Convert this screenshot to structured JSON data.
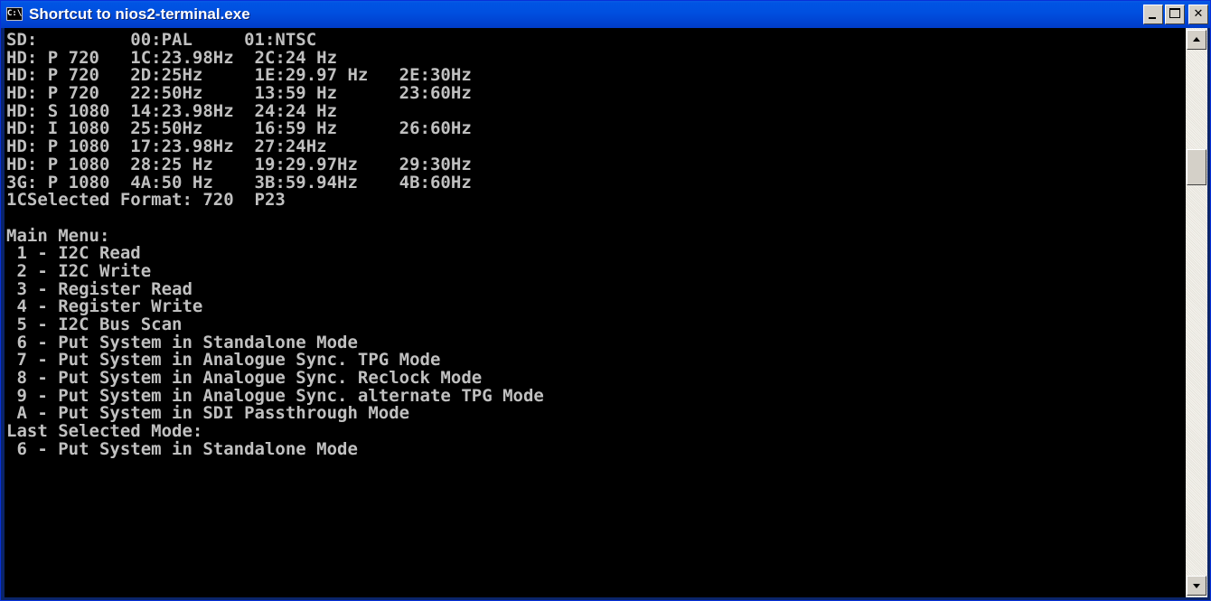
{
  "window": {
    "title": "Shortcut to nios2-terminal.exe",
    "icon": "console-icon",
    "icon_glyph": "C:\\",
    "controls": {
      "minimize": "minimize-icon",
      "maximize": "maximize-icon",
      "close_glyph": "✕"
    }
  },
  "console": {
    "lines": [
      "SD:         00:PAL     01:NTSC",
      "HD: P 720   1C:23.98Hz  2C:24 Hz",
      "HD: P 720   2D:25Hz     1E:29.97 Hz   2E:30Hz",
      "HD: P 720   22:50Hz     13:59 Hz      23:60Hz",
      "HD: S 1080  14:23.98Hz  24:24 Hz",
      "HD: I 1080  25:50Hz     16:59 Hz      26:60Hz",
      "HD: P 1080  17:23.98Hz  27:24Hz",
      "HD: P 1080  28:25 Hz    19:29.97Hz    29:30Hz",
      "3G: P 1080  4A:50 Hz    3B:59.94Hz    4B:60Hz",
      "1CSelected Format: 720  P23",
      "",
      "Main Menu:",
      " 1 - I2C Read",
      " 2 - I2C Write",
      " 3 - Register Read",
      " 4 - Register Write",
      " 5 - I2C Bus Scan",
      " 6 - Put System in Standalone Mode",
      " 7 - Put System in Analogue Sync. TPG Mode",
      " 8 - Put System in Analogue Sync. Reclock Mode",
      " 9 - Put System in Analogue Sync. alternate TPG Mode",
      " A - Put System in SDI Passthrough Mode",
      "Last Selected Mode:",
      " 6 - Put System in Standalone Mode"
    ],
    "text_color": "#c0c0c0",
    "background": "#000000"
  },
  "scrollbar": {
    "up_icon": "scroll-up-arrow-icon",
    "down_icon": "scroll-down-arrow-icon"
  },
  "colors": {
    "titlebar": "#0054e3",
    "title_text": "#ffffff"
  }
}
